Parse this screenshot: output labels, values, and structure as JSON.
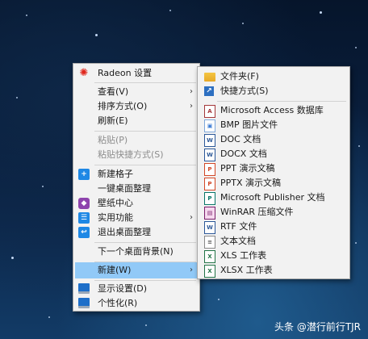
{
  "context_menu": {
    "items": [
      {
        "label": "Radeon 设置",
        "icon": "radeon-icon",
        "submenu": false,
        "disabled": false
      },
      {
        "label": "查看(V)",
        "submenu": true,
        "disabled": false
      },
      {
        "label": "排序方式(O)",
        "submenu": true,
        "disabled": false
      },
      {
        "label": "刷新(E)",
        "submenu": false,
        "disabled": false
      },
      {
        "label": "粘贴(P)",
        "submenu": false,
        "disabled": true
      },
      {
        "label": "粘贴快捷方式(S)",
        "submenu": false,
        "disabled": true
      },
      {
        "label": "新建格子",
        "icon": "new-grid-icon",
        "submenu": false,
        "disabled": false
      },
      {
        "label": "一键桌面整理",
        "submenu": false,
        "disabled": false
      },
      {
        "label": "壁纸中心",
        "icon": "wallpaper-icon",
        "submenu": false,
        "disabled": false
      },
      {
        "label": "实用功能",
        "icon": "tools-icon",
        "submenu": true,
        "disabled": false
      },
      {
        "label": "退出桌面整理",
        "icon": "exit-icon",
        "submenu": false,
        "disabled": false
      },
      {
        "label": "下一个桌面背景(N)",
        "submenu": false,
        "disabled": false
      },
      {
        "label": "新建(W)",
        "submenu": true,
        "disabled": false,
        "highlighted": true
      },
      {
        "label": "显示设置(D)",
        "icon": "display-icon",
        "submenu": false,
        "disabled": false
      },
      {
        "label": "个性化(R)",
        "icon": "personalize-icon",
        "submenu": false,
        "disabled": false
      }
    ]
  },
  "new_submenu": {
    "items": [
      {
        "label": "文件夹(F)",
        "icon": "folder-icon"
      },
      {
        "label": "快捷方式(S)",
        "icon": "shortcut-icon"
      },
      {
        "label": "Microsoft Access 数据库",
        "icon": "access-icon"
      },
      {
        "label": "BMP 图片文件",
        "icon": "bmp-icon"
      },
      {
        "label": "DOC 文档",
        "icon": "doc-icon"
      },
      {
        "label": "DOCX 文档",
        "icon": "docx-icon"
      },
      {
        "label": "PPT 演示文稿",
        "icon": "ppt-icon"
      },
      {
        "label": "PPTX 演示文稿",
        "icon": "pptx-icon"
      },
      {
        "label": "Microsoft Publisher 文档",
        "icon": "publisher-icon"
      },
      {
        "label": "WinRAR 压缩文件",
        "icon": "winrar-icon"
      },
      {
        "label": "RTF 文件",
        "icon": "rtf-icon"
      },
      {
        "label": "文本文档",
        "icon": "text-icon"
      },
      {
        "label": "XLS 工作表",
        "icon": "xls-icon"
      },
      {
        "label": "XLSX 工作表",
        "icon": "xlsx-icon"
      }
    ]
  },
  "watermark": "头条 @潜行前行TJR",
  "colors": {
    "highlight": "#91c9f7",
    "menu_bg": "#f2f2f2"
  }
}
